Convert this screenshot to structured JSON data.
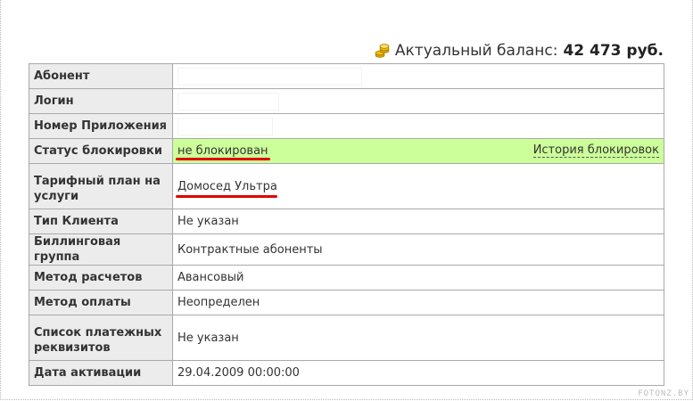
{
  "balance": {
    "label": "Актуальный баланс:",
    "amount": "42 473 руб."
  },
  "rows": [
    {
      "label": "Абонент",
      "value": ""
    },
    {
      "label": "Логин",
      "value": ""
    },
    {
      "label": "Номер Приложения",
      "value": ""
    },
    {
      "label": "Статус блокировки",
      "value": "не блокирован",
      "link": "История блокировок"
    },
    {
      "label": "Тарифный план на услуги",
      "value": "Домосед Ультра"
    },
    {
      "label": "Тип Клиента",
      "value": "Не указан"
    },
    {
      "label": "Биллинговая группа",
      "value": "Контрактные абоненты"
    },
    {
      "label": "Метод расчетов",
      "value": "Авансовый"
    },
    {
      "label": "Метод оплаты",
      "value": "Неопределен"
    },
    {
      "label": "Список платежных реквизитов",
      "value": "Не указан"
    },
    {
      "label": "Дата активации",
      "value": "29.04.2009 00:00:00"
    }
  ],
  "colors": {
    "status_highlight": "#ccff99",
    "label_bg": "#ececec",
    "annotation_underline": "#e00000"
  },
  "watermark": "FOTONZ.BY"
}
